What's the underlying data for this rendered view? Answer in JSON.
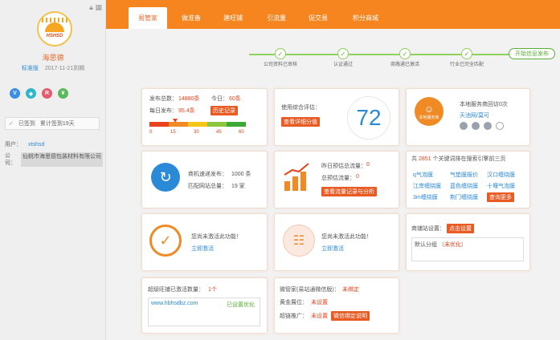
{
  "sidebar": {
    "company_name": "海思德",
    "version": "标准版",
    "expire": "2017-11-21到期",
    "logo_text": "HSHSD",
    "badges": [
      {
        "label": "V",
        "color": "#3a8ee6"
      },
      {
        "label": "◆",
        "color": "#2fb7c8"
      },
      {
        "label": "R",
        "color": "#e25b6f"
      },
      {
        "label": "¥",
        "color": "#5cb85c"
      }
    ],
    "signed": "已签到",
    "sign_days": "累计签到19天",
    "user_label": "用户：",
    "user_value": "xtshsd",
    "corp_label": "公司：",
    "corp_value": "仙桃市海思德包装材料有限公司"
  },
  "tabs": [
    "易管家",
    "做准备",
    "建旺铺",
    "引流量",
    "促交易",
    "积分商城"
  ],
  "steps": [
    {
      "label": "公司资料已审核"
    },
    {
      "label": "认证通过"
    },
    {
      "label": "商路通已激活"
    },
    {
      "label": "行业已完全匹配"
    }
  ],
  "step_button": "开始信息发布",
  "stats": {
    "total_label": "发布总数：",
    "total_value": "14880条",
    "today_label": "今日：",
    "today_value": "60条",
    "daily_label": "每日发布：",
    "daily_value": "95.4条",
    "history_btn": "历史记录",
    "gauge_ticks": [
      "0",
      "15",
      "30",
      "45",
      "60"
    ]
  },
  "rating": {
    "label": "使用综合评估：",
    "btn": "查看详细分值",
    "score": "72"
  },
  "service": {
    "visits": "本地服务商回访0次",
    "name": "天池网/莫可",
    "avatar_label": "本地服务商"
  },
  "speed": {
    "merchants_label": "商机速递发布：",
    "merchants_value": "1000 条",
    "shops_label": "匹配网站总量：",
    "shops_value": "19 家"
  },
  "traffic": {
    "yesterday_label": "昨日预估总流量：",
    "yesterday_value": "0",
    "total_label": "总预估流量：",
    "total_value": "0",
    "btn": "查看流量记录与分析"
  },
  "keywords": {
    "intro_pre": "共",
    "count": "2851",
    "intro_post": "个关键词排在搜索引擎前三页",
    "items": [
      "q气泡膜",
      "气垫膜报价",
      "汉口缠绕膜",
      "江岸缠绕膜",
      "蓝色缠绕膜",
      "十堰气泡膜",
      "3m缠绕膜",
      "荆门缠绕膜"
    ],
    "more_btn": "查询更多"
  },
  "inactive1": {
    "text": "您尚未激活此功能！",
    "link": "立即激活"
  },
  "inactive2": {
    "text": "您尚未激活此功能！",
    "link": "立即激活"
  },
  "wangpu": {
    "label": "商铺站设置：",
    "btn": "点击设置",
    "default": "默认分组",
    "status": "（未优化）"
  },
  "superShop": {
    "label": "超级旺铺已激活数量：",
    "count": "1个",
    "url": "www.hbhsdbz.com",
    "status": "已设置优化"
  },
  "wechat": {
    "row1_label": "微管家(易站通微信版)：",
    "row1_value": "未绑定",
    "row2_label": "黄金展位：",
    "row2_value": "未设置",
    "row3_label": "超链推广：",
    "row3_value": "未设置",
    "btn": "微信绑定说明"
  }
}
